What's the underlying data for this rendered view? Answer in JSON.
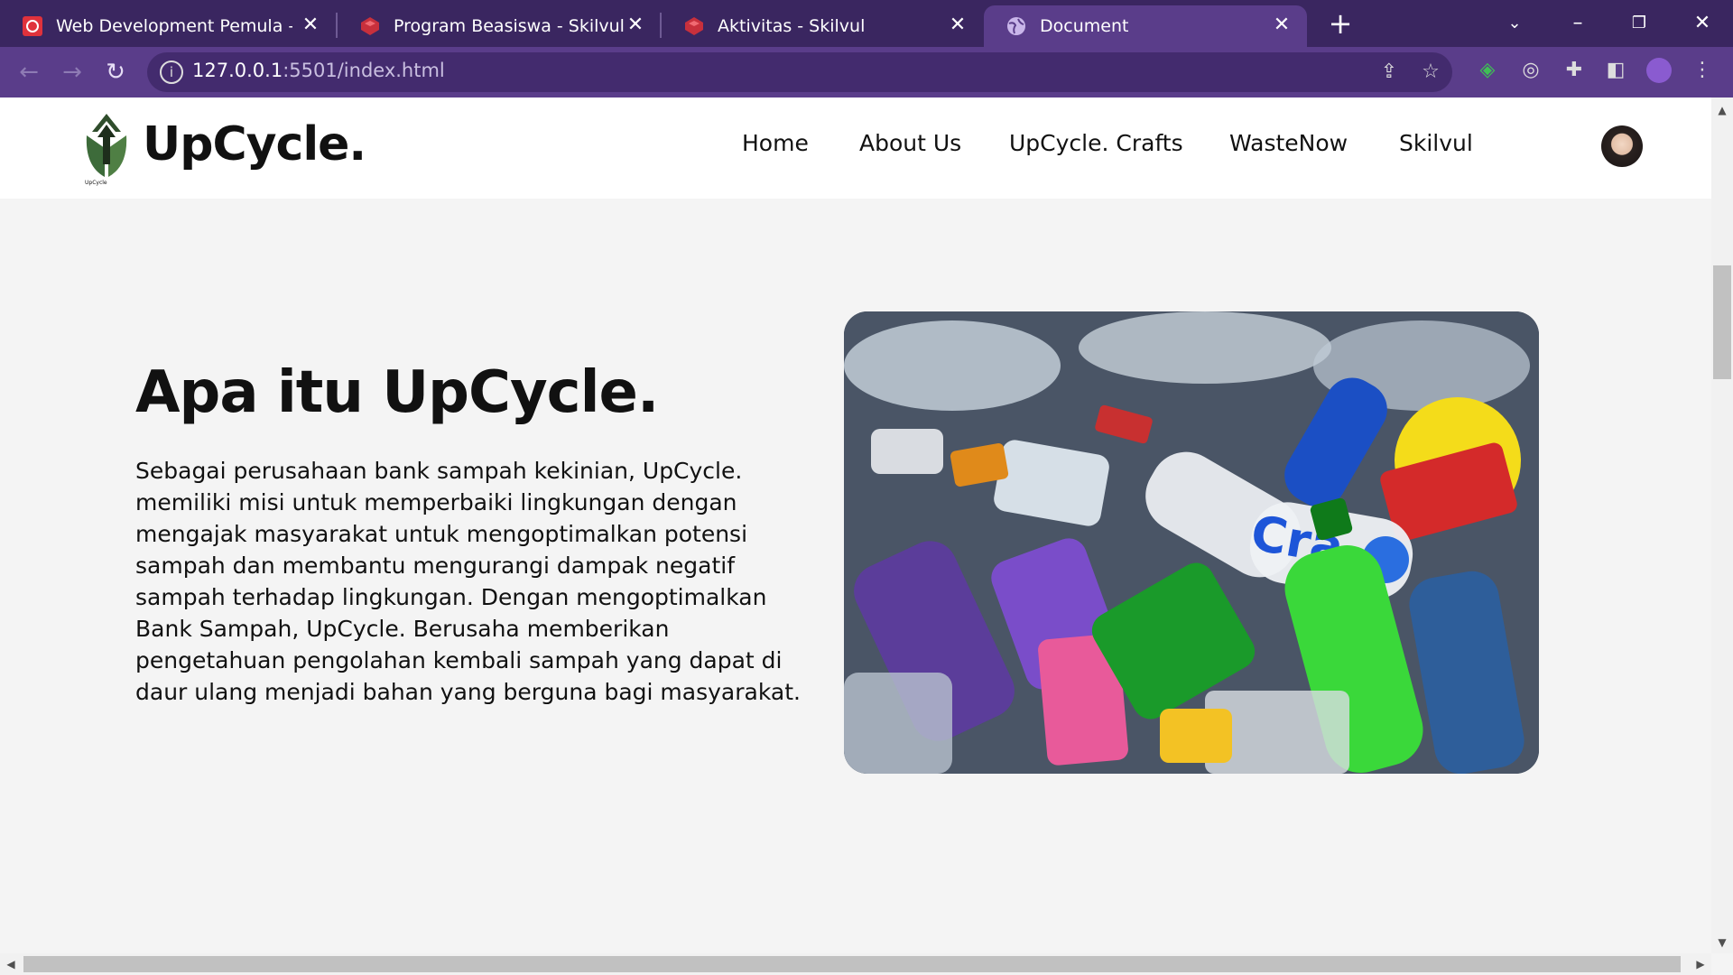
{
  "browser": {
    "tabs": [
      {
        "title": "Web Development Pemula - Spesialisasi",
        "favicon": "skilvul-red-icon"
      },
      {
        "title": "Program Beasiswa - Skilvul",
        "favicon": "skilvul-icon"
      },
      {
        "title": "Aktivitas - Skilvul",
        "favicon": "skilvul-icon"
      },
      {
        "title": "Document",
        "favicon": "globe-icon",
        "active": true
      }
    ],
    "url_host": "127.0.0.1",
    "url_rest": ":5501/index.html"
  },
  "site": {
    "brand": "UpCycle.",
    "nav": [
      "Home",
      "About Us",
      "UpCycle. Crafts",
      "WasteNow",
      "Skilvul"
    ]
  },
  "hero": {
    "title": "Apa itu UpCycle.",
    "text": "Sebagai perusahaan bank sampah kekinian, UpCycle. memiliki misi untuk memperbaiki lingkungan dengan mengajak masyarakat untuk mengoptimalkan potensi sampah dan membantu mengurangi dampak negatif sampah terhadap lingkungan. Dengan mengoptimalkan Bank Sampah, UpCycle. Berusaha memberikan pengetahuan pengolahan kembali sampah yang dapat di daur ulang menjadi bahan yang berguna bagi masyarakat.",
    "image": "plastic-bottles-photo"
  },
  "colors": {
    "chrome_dark": "#3a2660",
    "chrome": "#5a3d8a",
    "logo_green": "#3d6b3a"
  }
}
